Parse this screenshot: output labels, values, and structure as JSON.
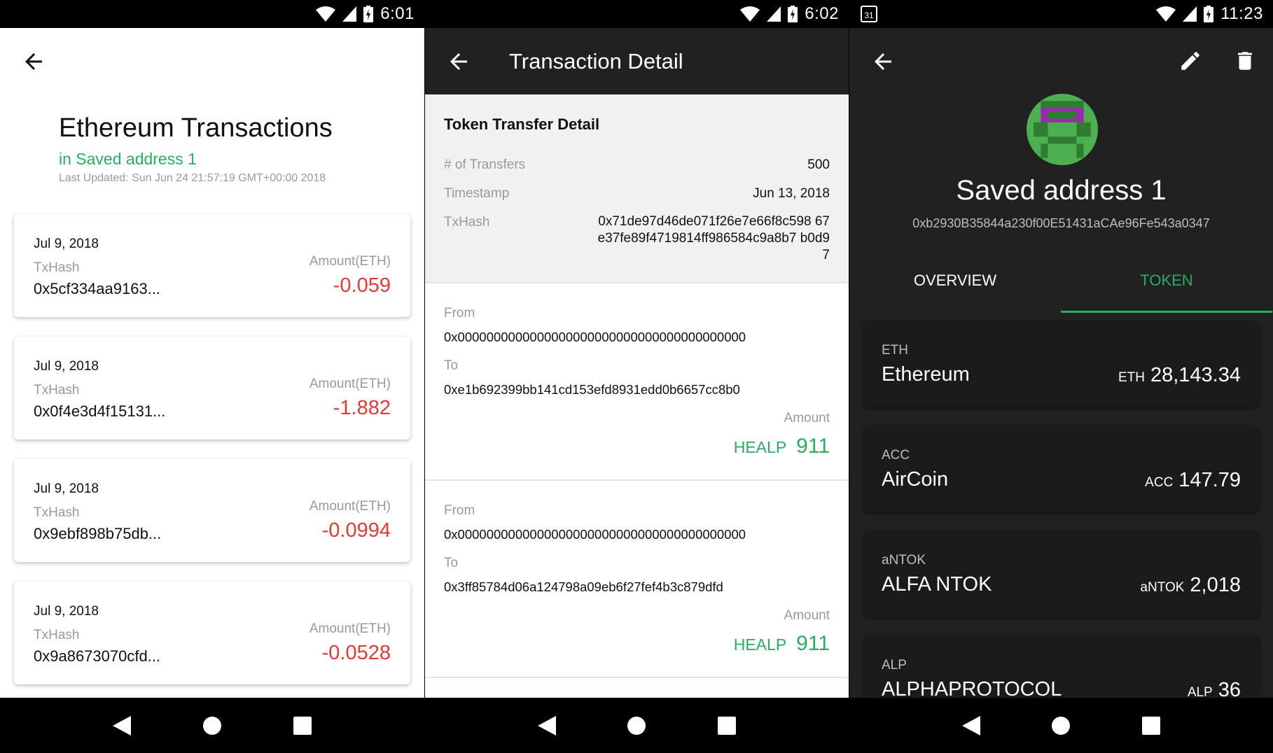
{
  "screen1": {
    "status_time": "6:01",
    "title": "Ethereum Transactions",
    "subtitle": "in Saved address 1",
    "last_updated": "Last Updated: Sun Jun 24 21:57:19 GMT+00:00 2018",
    "txhash_label": "TxHash",
    "amount_label": "Amount(ETH)",
    "transactions": [
      {
        "date": "Jul 9, 2018",
        "hash": "0x5cf334aa9163...",
        "amount": "-0.059"
      },
      {
        "date": "Jul 9, 2018",
        "hash": "0x0f4e3d4f15131...",
        "amount": "-1.882"
      },
      {
        "date": "Jul 9, 2018",
        "hash": "0x9ebf898b75db...",
        "amount": "-0.0994"
      },
      {
        "date": "Jul 9, 2018",
        "hash": "0x9a8673070cfd...",
        "amount": "-0.0528"
      }
    ]
  },
  "screen2": {
    "status_time": "6:02",
    "title": "Transaction Detail",
    "summary": {
      "heading": "Token Transfer Detail",
      "transfers_label": "# of Transfers",
      "transfers_value": "500",
      "timestamp_label": "Timestamp",
      "timestamp_value": "Jun 13, 2018",
      "txhash_label": "TxHash",
      "txhash_value": "0x71de97d46de071f26e7e66f8c598 67e37fe89f4719814ff986584c9a8b7 b0d97"
    },
    "from_label": "From",
    "to_label": "To",
    "amount_label": "Amount",
    "transfers": [
      {
        "from": "0x0000000000000000000000000000000000000000",
        "to": "0xe1b692399bb141cd153efd8931edd0b6657cc8b0",
        "symbol": "HEALP",
        "amount": "911"
      },
      {
        "from": "0x0000000000000000000000000000000000000000",
        "to": "0x3ff85784d06a124798a09eb6f27fef4b3c879dfd",
        "symbol": "HEALP",
        "amount": "911"
      }
    ]
  },
  "screen3": {
    "status_time": "11:23",
    "calendar_day": "31",
    "name": "Saved address 1",
    "address": "0xb2930B35844a230f00E51431aCAe96Fe543a0347",
    "tabs": [
      "OVERVIEW",
      "TOKEN"
    ],
    "active_tab": "TOKEN",
    "tokens": [
      {
        "symbol": "ETH",
        "name": "Ethereum",
        "unit": "ETH",
        "balance": "28,143.34"
      },
      {
        "symbol": "ACC",
        "name": "AirCoin",
        "unit": "ACC",
        "balance": "147.79"
      },
      {
        "symbol": "aNTOK",
        "name": "ALFA NTOK",
        "unit": "aNTOK",
        "balance": "2,018"
      },
      {
        "symbol": "ALP",
        "name": "ALPHAPROTOCOL",
        "unit": "ALP",
        "balance": "36"
      }
    ]
  },
  "colors": {
    "accent_green": "#27ae60",
    "negative_red": "#e53935",
    "dark_bg": "#212121"
  }
}
